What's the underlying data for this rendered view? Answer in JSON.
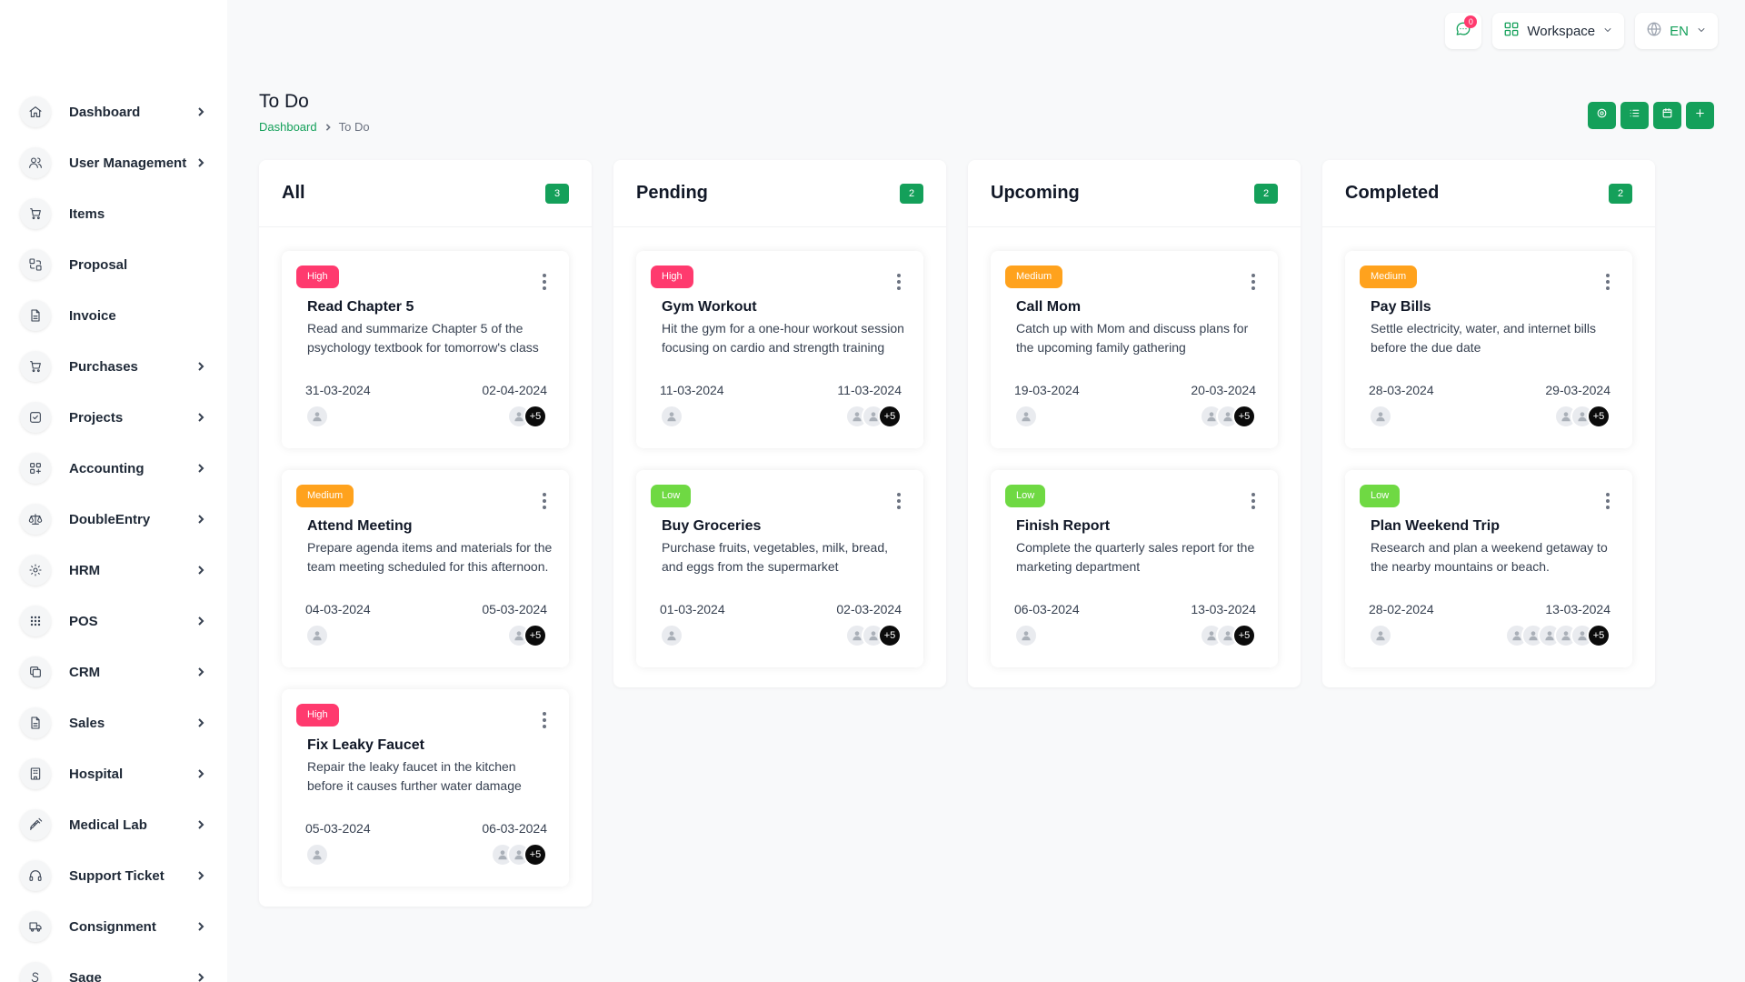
{
  "header": {
    "notification_count": "0",
    "workspace_label": "Workspace",
    "language_label": "EN"
  },
  "page": {
    "title": "To Do",
    "breadcrumb": [
      "Dashboard",
      "To Do"
    ]
  },
  "sidebar": {
    "items": [
      {
        "label": "Dashboard",
        "icon": "home-icon",
        "has_children": true
      },
      {
        "label": "User Management",
        "icon": "users-icon",
        "has_children": true
      },
      {
        "label": "Items",
        "icon": "cart-icon",
        "has_children": false
      },
      {
        "label": "Proposal",
        "icon": "proposal-icon",
        "has_children": false
      },
      {
        "label": "Invoice",
        "icon": "file-icon",
        "has_children": false
      },
      {
        "label": "Purchases",
        "icon": "cart-icon",
        "has_children": true
      },
      {
        "label": "Projects",
        "icon": "checkbox-icon",
        "has_children": true
      },
      {
        "label": "Accounting",
        "icon": "layout-grid-icon",
        "has_children": true
      },
      {
        "label": "DoubleEntry",
        "icon": "scale-icon",
        "has_children": true
      },
      {
        "label": "HRM",
        "icon": "hrm-icon",
        "has_children": true
      },
      {
        "label": "POS",
        "icon": "dots-grid-icon",
        "has_children": true
      },
      {
        "label": "CRM",
        "icon": "layers-icon",
        "has_children": true
      },
      {
        "label": "Sales",
        "icon": "file-icon",
        "has_children": true
      },
      {
        "label": "Hospital",
        "icon": "building-icon",
        "has_children": true
      },
      {
        "label": "Medical Lab",
        "icon": "syringe-icon",
        "has_children": true
      },
      {
        "label": "Support Ticket",
        "icon": "headset-icon",
        "has_children": true
      },
      {
        "label": "Consignment",
        "icon": "truck-icon",
        "has_children": true
      },
      {
        "label": "Sage",
        "icon": "sage-icon",
        "has_children": true
      }
    ]
  },
  "colors": {
    "accent": "#14a05a",
    "high": "#ff3a6e",
    "medium": "#ffa21d",
    "low": "#6fd943"
  },
  "board": {
    "columns": [
      {
        "title": "All",
        "count": "3",
        "cards": [
          {
            "priority": "High",
            "level": "high",
            "title": "Read Chapter 5",
            "description": "Read and summarize Chapter 5 of the psychology textbook for tomorrow's class",
            "start_date": "31-03-2024",
            "end_date": "02-04-2024",
            "assigned_avatars": 1,
            "team_avatars": 1,
            "more_count": "+5"
          },
          {
            "priority": "Medium",
            "level": "medium",
            "title": "Attend Meeting",
            "description": "Prepare agenda items and materials for the team meeting scheduled for this afternoon.",
            "start_date": "04-03-2024",
            "end_date": "05-03-2024",
            "assigned_avatars": 1,
            "team_avatars": 1,
            "more_count": "+5"
          },
          {
            "priority": "High",
            "level": "high",
            "title": "Fix Leaky Faucet",
            "description": "Repair the leaky faucet in the kitchen before it causes further water damage",
            "start_date": "05-03-2024",
            "end_date": "06-03-2024",
            "assigned_avatars": 1,
            "team_avatars": 2,
            "more_count": "+5"
          }
        ]
      },
      {
        "title": "Pending",
        "count": "2",
        "cards": [
          {
            "priority": "High",
            "level": "high",
            "title": "Gym Workout",
            "description": "Hit the gym for a one-hour workout session focusing on cardio and strength training",
            "start_date": "11-03-2024",
            "end_date": "11-03-2024",
            "assigned_avatars": 1,
            "team_avatars": 2,
            "more_count": "+5"
          },
          {
            "priority": "Low",
            "level": "low",
            "title": "Buy Groceries",
            "description": "Purchase fruits, vegetables, milk, bread, and eggs from the supermarket",
            "start_date": "01-03-2024",
            "end_date": "02-03-2024",
            "assigned_avatars": 1,
            "team_avatars": 2,
            "more_count": "+5"
          }
        ]
      },
      {
        "title": "Upcoming",
        "count": "2",
        "cards": [
          {
            "priority": "Medium",
            "level": "medium",
            "title": "Call Mom",
            "description": "Catch up with Mom and discuss plans for the upcoming family gathering",
            "start_date": "19-03-2024",
            "end_date": "20-03-2024",
            "assigned_avatars": 1,
            "team_avatars": 2,
            "more_count": "+5"
          },
          {
            "priority": "Low",
            "level": "low",
            "title": "Finish Report",
            "description": "Complete the quarterly sales report for the marketing department",
            "start_date": "06-03-2024",
            "end_date": "13-03-2024",
            "assigned_avatars": 1,
            "team_avatars": 2,
            "more_count": "+5"
          }
        ]
      },
      {
        "title": "Completed",
        "count": "2",
        "cards": [
          {
            "priority": "Medium",
            "level": "medium",
            "title": "Pay Bills",
            "description": "Settle electricity, water, and internet bills before the due date",
            "start_date": "28-03-2024",
            "end_date": "29-03-2024",
            "assigned_avatars": 1,
            "team_avatars": 2,
            "more_count": "+5"
          },
          {
            "priority": "Low",
            "level": "low",
            "title": "Plan Weekend Trip",
            "description": "Research and plan a weekend getaway to the nearby mountains or beach.",
            "start_date": "28-02-2024",
            "end_date": "13-03-2024",
            "assigned_avatars": 1,
            "team_avatars": 5,
            "more_count": "+5"
          }
        ]
      }
    ]
  }
}
